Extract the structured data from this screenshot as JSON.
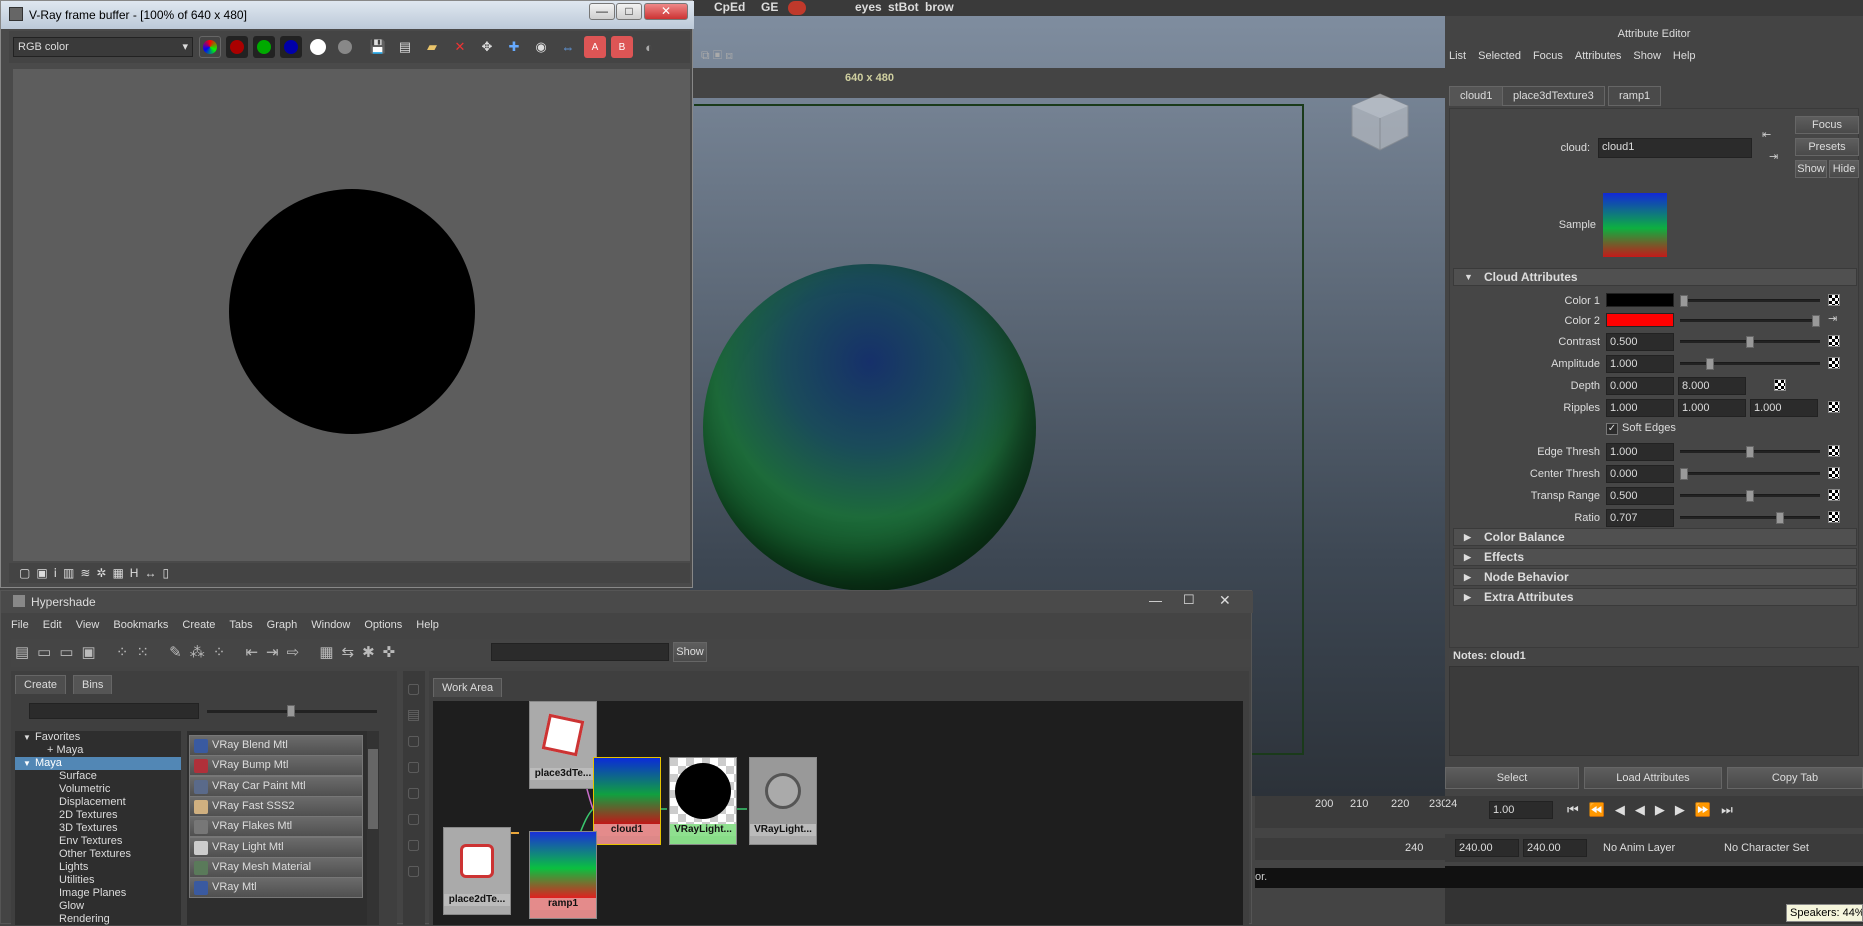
{
  "top_shelf": {
    "items": [
      "CpEd",
      "GE",
      "eyes",
      "stBot",
      "brow"
    ]
  },
  "viewport": {
    "resolution_label": "640 x 480"
  },
  "vray": {
    "title": "V-Ray frame buffer - [100% of 640 x 480]",
    "channel": "RGB color",
    "min_label": "—",
    "max_label": "□",
    "close_label": "✕"
  },
  "hypershade": {
    "title": "Hypershade",
    "menu": [
      "File",
      "Edit",
      "View",
      "Bookmarks",
      "Create",
      "Tabs",
      "Graph",
      "Window",
      "Options",
      "Help"
    ],
    "show_label": "Show",
    "tabs": {
      "create": "Create",
      "bins": "Bins",
      "work_area": "Work Area"
    },
    "tree": [
      {
        "label": "Favorites",
        "indent": 0,
        "expander": "▼"
      },
      {
        "label": "+ Maya",
        "indent": 1,
        "expander": ""
      },
      {
        "label": "Maya",
        "indent": 0,
        "expander": "▼",
        "selected": true
      },
      {
        "label": "Surface",
        "indent": 2,
        "expander": ""
      },
      {
        "label": "Volumetric",
        "indent": 2,
        "expander": ""
      },
      {
        "label": "Displacement",
        "indent": 2,
        "expander": ""
      },
      {
        "label": "2D Textures",
        "indent": 2,
        "expander": ""
      },
      {
        "label": "3D Textures",
        "indent": 2,
        "expander": ""
      },
      {
        "label": "Env Textures",
        "indent": 2,
        "expander": ""
      },
      {
        "label": "Other Textures",
        "indent": 2,
        "expander": ""
      },
      {
        "label": "Lights",
        "indent": 2,
        "expander": ""
      },
      {
        "label": "Utilities",
        "indent": 2,
        "expander": ""
      },
      {
        "label": "Image Planes",
        "indent": 2,
        "expander": ""
      },
      {
        "label": "Glow",
        "indent": 2,
        "expander": ""
      },
      {
        "label": "Rendering",
        "indent": 2,
        "expander": ""
      }
    ],
    "node_buttons": [
      {
        "label": "VRay Blend Mtl",
        "color": "#3a5aa0"
      },
      {
        "label": "VRay Bump Mtl",
        "color": "#b0303a"
      },
      {
        "label": "VRay Car Paint Mtl",
        "color": "#5a6a8a"
      },
      {
        "label": "VRay Fast SSS2",
        "color": "#d0b080"
      },
      {
        "label": "VRay Flakes Mtl",
        "color": "#777777"
      },
      {
        "label": "VRay Light Mtl",
        "color": "#cccccc"
      },
      {
        "label": "VRay Mesh Material",
        "color": "#5a7a5a"
      },
      {
        "label": "VRay Mtl",
        "color": "#3a5aa0"
      }
    ],
    "nodes": {
      "place3d": "place3dTe...",
      "place2d": "place2dTe...",
      "cloud": "cloud1",
      "ramp": "ramp1",
      "vraylight1": "VRayLight...",
      "vraylight2": "VRayLight..."
    }
  },
  "attribute_editor": {
    "title": "Attribute Editor",
    "menu": [
      "List",
      "Selected",
      "Focus",
      "Attributes",
      "Show",
      "Help"
    ],
    "tabs": [
      "cloud1",
      "place3dTexture3",
      "ramp1"
    ],
    "node_label": "cloud:",
    "node_name": "cloud1",
    "buttons": {
      "focus": "Focus",
      "presets": "Presets",
      "show": "Show",
      "hide": "Hide"
    },
    "sample_label": "Sample",
    "section_cloud": "Cloud Attributes",
    "attrs": {
      "color1_label": "Color 1",
      "color1": "#000000",
      "color2_label": "Color 2",
      "color2": "#ff0000",
      "contrast_label": "Contrast",
      "contrast": "0.500",
      "amplitude_label": "Amplitude",
      "amplitude": "1.000",
      "depth_label": "Depth",
      "depth_min": "0.000",
      "depth_max": "8.000",
      "ripples_label": "Ripples",
      "ripples_x": "1.000",
      "ripples_y": "1.000",
      "ripples_z": "1.000",
      "soft_edges_label": "Soft Edges",
      "soft_edges_checked": true,
      "edge_thresh_label": "Edge Thresh",
      "edge_thresh": "1.000",
      "center_thresh_label": "Center Thresh",
      "center_thresh": "0.000",
      "transp_range_label": "Transp Range",
      "transp_range": "0.500",
      "ratio_label": "Ratio",
      "ratio": "0.707"
    },
    "collapsed_sections": [
      "Color Balance",
      "Effects",
      "Node Behavior",
      "Extra Attributes"
    ],
    "notes_label": "Notes:  cloud1",
    "bottom_buttons": {
      "select": "Select",
      "load": "Load Attributes",
      "copy": "Copy Tab"
    }
  },
  "timeline": {
    "ticks": [
      "200",
      "210",
      "220",
      "230",
      "24"
    ],
    "current_frame": "1.00",
    "range_end_inner": "240",
    "range_end1": "240.00",
    "range_end2": "240.00",
    "anim_layer": "No Anim Layer",
    "character_set": "No Character Set"
  },
  "statusline": {
    "text": "or."
  },
  "tray": {
    "speakers": "Speakers: 44%"
  }
}
